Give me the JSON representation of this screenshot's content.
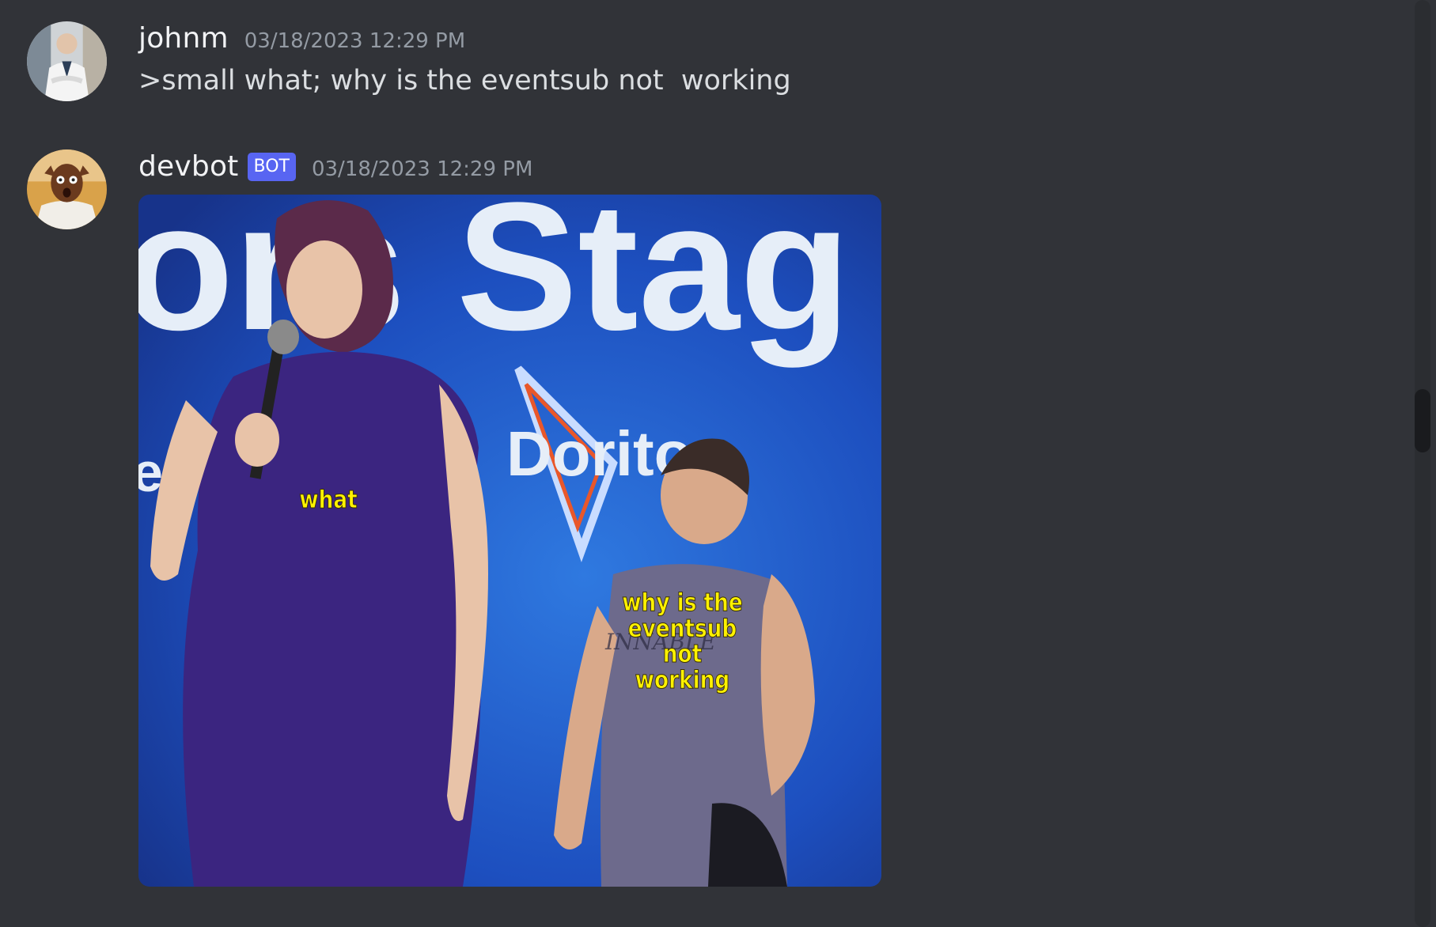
{
  "messages": [
    {
      "username": "johnm",
      "timestamp": "03/18/2023 12:29 PM",
      "content": ">small what; why is the eventsub not  working",
      "avatar": "user-avatar-icon"
    },
    {
      "username": "devbot",
      "bot_tag": "BOT",
      "timestamp": "03/18/2023 12:29 PM",
      "avatar": "bot-avatar-icon",
      "image": {
        "subject": "meme-image",
        "caption_small_person": "what",
        "caption_big_person": "why is the eventsub not working",
        "background_text_large": "ors Stag",
        "background_text_logo": "Dorito",
        "shirt_text": "INNABLE"
      }
    }
  ],
  "colors": {
    "background": "#313338",
    "username": "#f2f3f5",
    "timestamp": "#949ba4",
    "text": "#dbdee1",
    "bot_tag": "#5865f2",
    "caption": "#fff200"
  }
}
